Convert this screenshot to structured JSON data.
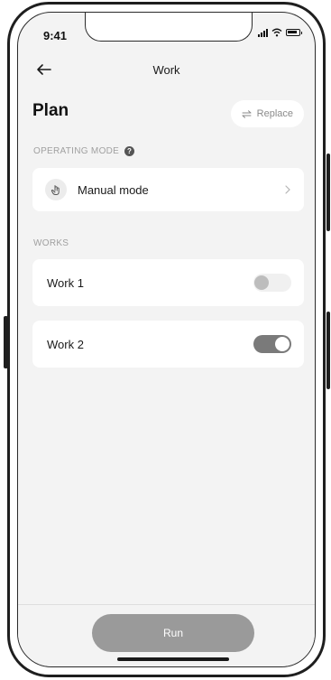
{
  "status_bar": {
    "time": "9:41"
  },
  "nav": {
    "title": "Work"
  },
  "plan": {
    "title": "Plan",
    "replace_label": "Replace"
  },
  "operating_mode": {
    "section_label": "OPERATING MODE",
    "help_glyph": "?",
    "mode_label": "Manual mode",
    "icon": "hand-pointer-icon"
  },
  "works": {
    "section_label": "WORKS",
    "items": [
      {
        "label": "Work 1",
        "enabled": false
      },
      {
        "label": "Work 2",
        "enabled": true
      }
    ]
  },
  "footer": {
    "run_label": "Run"
  },
  "colors": {
    "screen_background": "#f3f3f3",
    "card_background": "#ffffff",
    "toggle_on": "#7a7a7a",
    "toggle_off": "#f0f0f0",
    "run_button": "#9a9a9a",
    "muted_text": "#a0a0a0"
  }
}
